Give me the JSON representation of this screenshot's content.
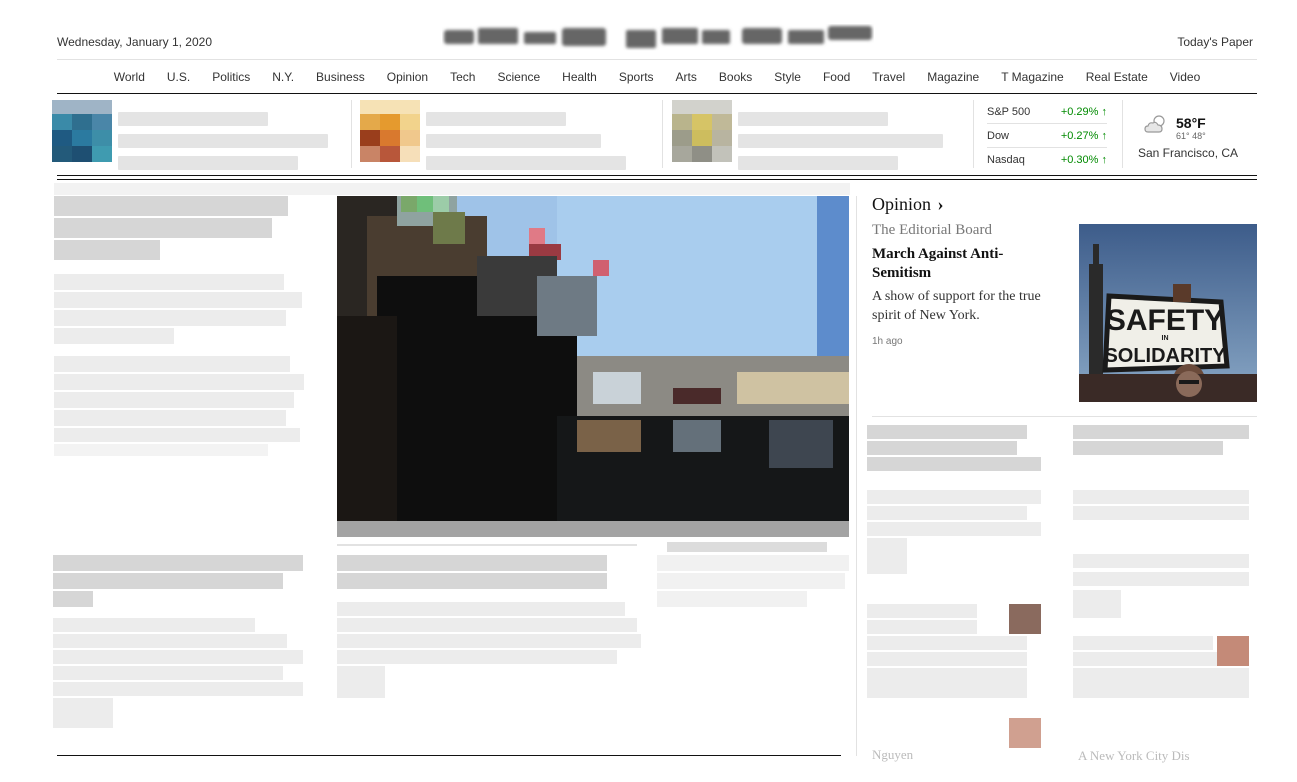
{
  "masthead": {
    "date": "Wednesday, January 1, 2020",
    "todays_paper": "Today's Paper"
  },
  "nav": {
    "items": [
      "World",
      "U.S.",
      "Politics",
      "N.Y.",
      "Business",
      "Opinion",
      "Tech",
      "Science",
      "Health",
      "Sports",
      "Arts",
      "Books",
      "Style",
      "Food",
      "Travel",
      "Magazine",
      "T Magazine",
      "Real Estate",
      "Video"
    ]
  },
  "markets": [
    {
      "name": "S&P 500",
      "change": "+0.29%",
      "arrow": "↑"
    },
    {
      "name": "Dow",
      "change": "+0.27%",
      "arrow": "↑"
    },
    {
      "name": "Nasdaq",
      "change": "+0.30%",
      "arrow": "↑"
    }
  ],
  "weather": {
    "temp": "58°F",
    "high": "61°",
    "low": "48°",
    "location": "San Francisco, CA",
    "icon": "partly-cloudy-icon"
  },
  "opinion": {
    "section_label": "Opinion",
    "chevron": "›",
    "byline": "The Editorial Board",
    "headline": "March Against Anti-Semitism",
    "summary": "A show of support for the true spirit of New York.",
    "time": "1h ago",
    "sign_text": [
      "SAFETY",
      "IN",
      "SOLIDARITY"
    ]
  },
  "bottom_fragments": {
    "left": "Nguyen",
    "right": "A New York City Dis"
  },
  "colors": {
    "market_up": "#008a00",
    "text": "#121212",
    "muted": "#777777"
  }
}
